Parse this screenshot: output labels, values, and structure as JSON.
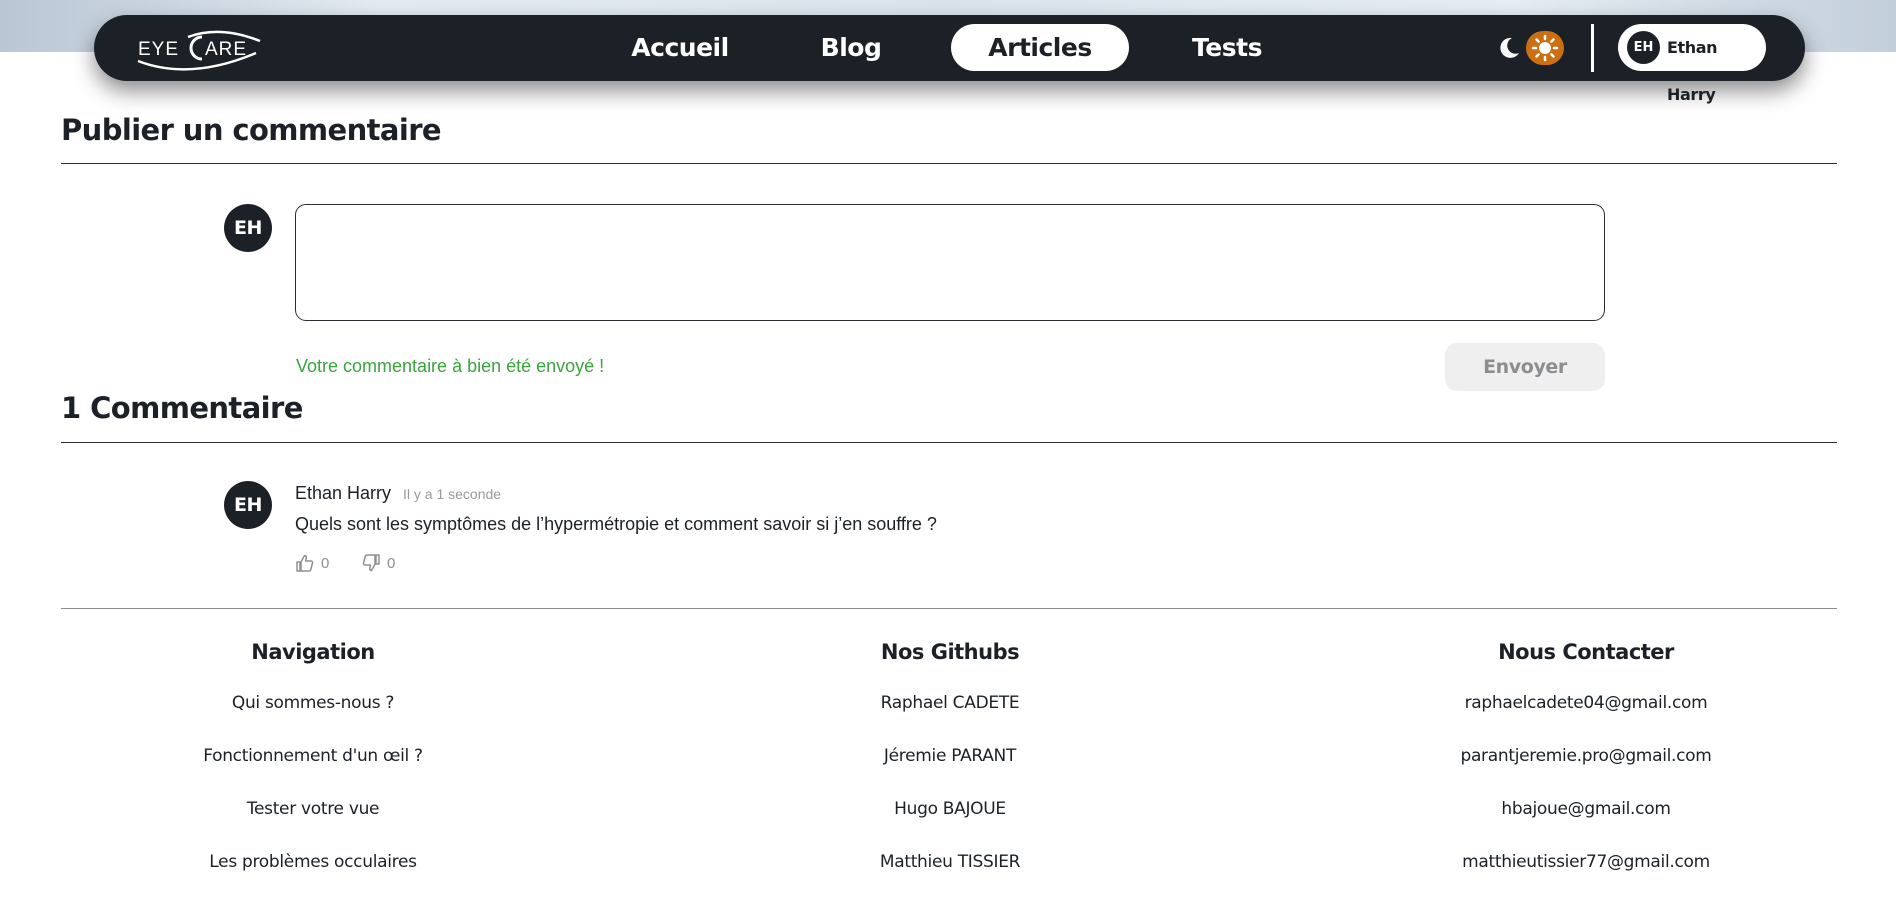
{
  "nav": {
    "logo_text": "EYE CARE",
    "links": [
      {
        "label": "Accueil",
        "active": false
      },
      {
        "label": "Blog",
        "active": false
      },
      {
        "label": "Articles",
        "active": true
      },
      {
        "label": "Tests",
        "active": false
      }
    ],
    "user": {
      "initials": "EH",
      "name": "Ethan Harry"
    },
    "icons": {
      "moon": "moon-icon",
      "sun": "sun-icon"
    },
    "colors": {
      "nav_bg": "#1b2127",
      "sun_bg": "#cc6f12"
    }
  },
  "publish": {
    "title": "Publier un commentaire",
    "avatar_initials": "EH",
    "textarea_value": "",
    "success_message": "Votre commentaire à bien été envoyé !",
    "send_label": "Envoyer"
  },
  "comments": {
    "title": "1 Commentaire",
    "items": [
      {
        "initials": "EH",
        "author": "Ethan Harry",
        "time": "Il y a 1 seconde",
        "text": "Quels sont les symptômes de l’hypermétropie et comment savoir si j’en souffre ?",
        "likes": "0",
        "dislikes": "0"
      }
    ]
  },
  "footer": {
    "columns": [
      {
        "title": "Navigation",
        "links": [
          "Qui sommes-nous ?",
          "Fonctionnement d'un œil ?",
          "Tester votre vue",
          "Les problèmes occulaires"
        ]
      },
      {
        "title": "Nos Githubs",
        "links": [
          "Raphael CADETE",
          "Jéremie PARANT",
          "Hugo BAJOUE",
          "Matthieu TISSIER"
        ]
      },
      {
        "title": "Nous Contacter",
        "links": [
          "raphaelcadete04@gmail.com",
          "parantjeremie.pro@gmail.com",
          "hbajoue@gmail.com",
          "matthieutissier77@gmail.com"
        ]
      }
    ]
  }
}
